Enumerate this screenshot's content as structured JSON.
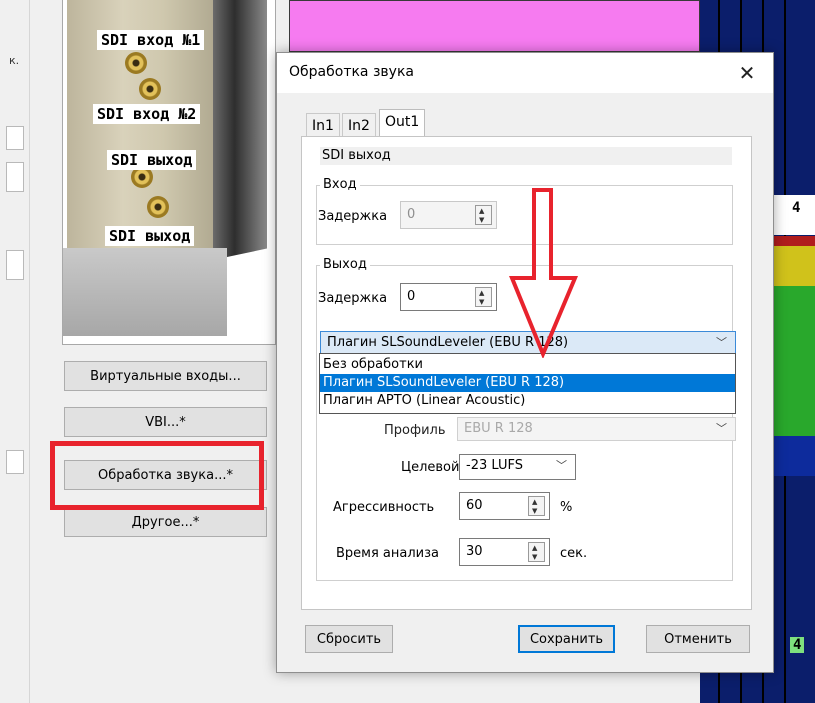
{
  "background": {
    "left_fragment_text": "к.",
    "sdi_labels": [
      "SDI вход №1",
      "SDI вход №2",
      "SDI выход",
      "SDI выход"
    ],
    "side_buttons": [
      "Виртуальные входы...",
      "VBI...*",
      "Обработка звука...*",
      "Другое...*"
    ],
    "meter_numbers": [
      "4",
      "4"
    ],
    "colors": {
      "magenta": "#f67bf0",
      "meter_blue": "#0b1e6b",
      "highlight_red": "#e8232d"
    }
  },
  "dialog": {
    "title": "Обработка звука",
    "close_icon": "close-icon",
    "tabs": [
      {
        "label": "In1",
        "active": false
      },
      {
        "label": "In2",
        "active": false
      },
      {
        "label": "Out1",
        "active": true
      }
    ],
    "section_title": "SDI выход",
    "input_group": {
      "title": "Вход",
      "delay_label": "Задержка",
      "delay_value": "0"
    },
    "output_group": {
      "title": "Выход",
      "delay_label": "Задержка",
      "delay_value": "0",
      "plugin_selected": "Плагин SLSoundLeveler (EBU R 128)",
      "plugin_options": [
        "Без обработки",
        "Плагин SLSoundLeveler (EBU R 128)",
        "Плагин APTO (Linear Acoustic)"
      ],
      "profile_label": "Профиль",
      "profile_value": "EBU R 128",
      "target_label": "Целевой",
      "target_value": "-23 LUFS",
      "aggressiveness_label": "Агрессивность",
      "aggressiveness_value": "60",
      "aggressiveness_unit": "%",
      "analysis_label": "Время анализа",
      "analysis_value": "30",
      "analysis_unit": "сек."
    },
    "buttons": {
      "reset": "Сбросить",
      "save": "Сохранить",
      "cancel": "Отменить"
    },
    "accent_color": "#0078d7"
  }
}
